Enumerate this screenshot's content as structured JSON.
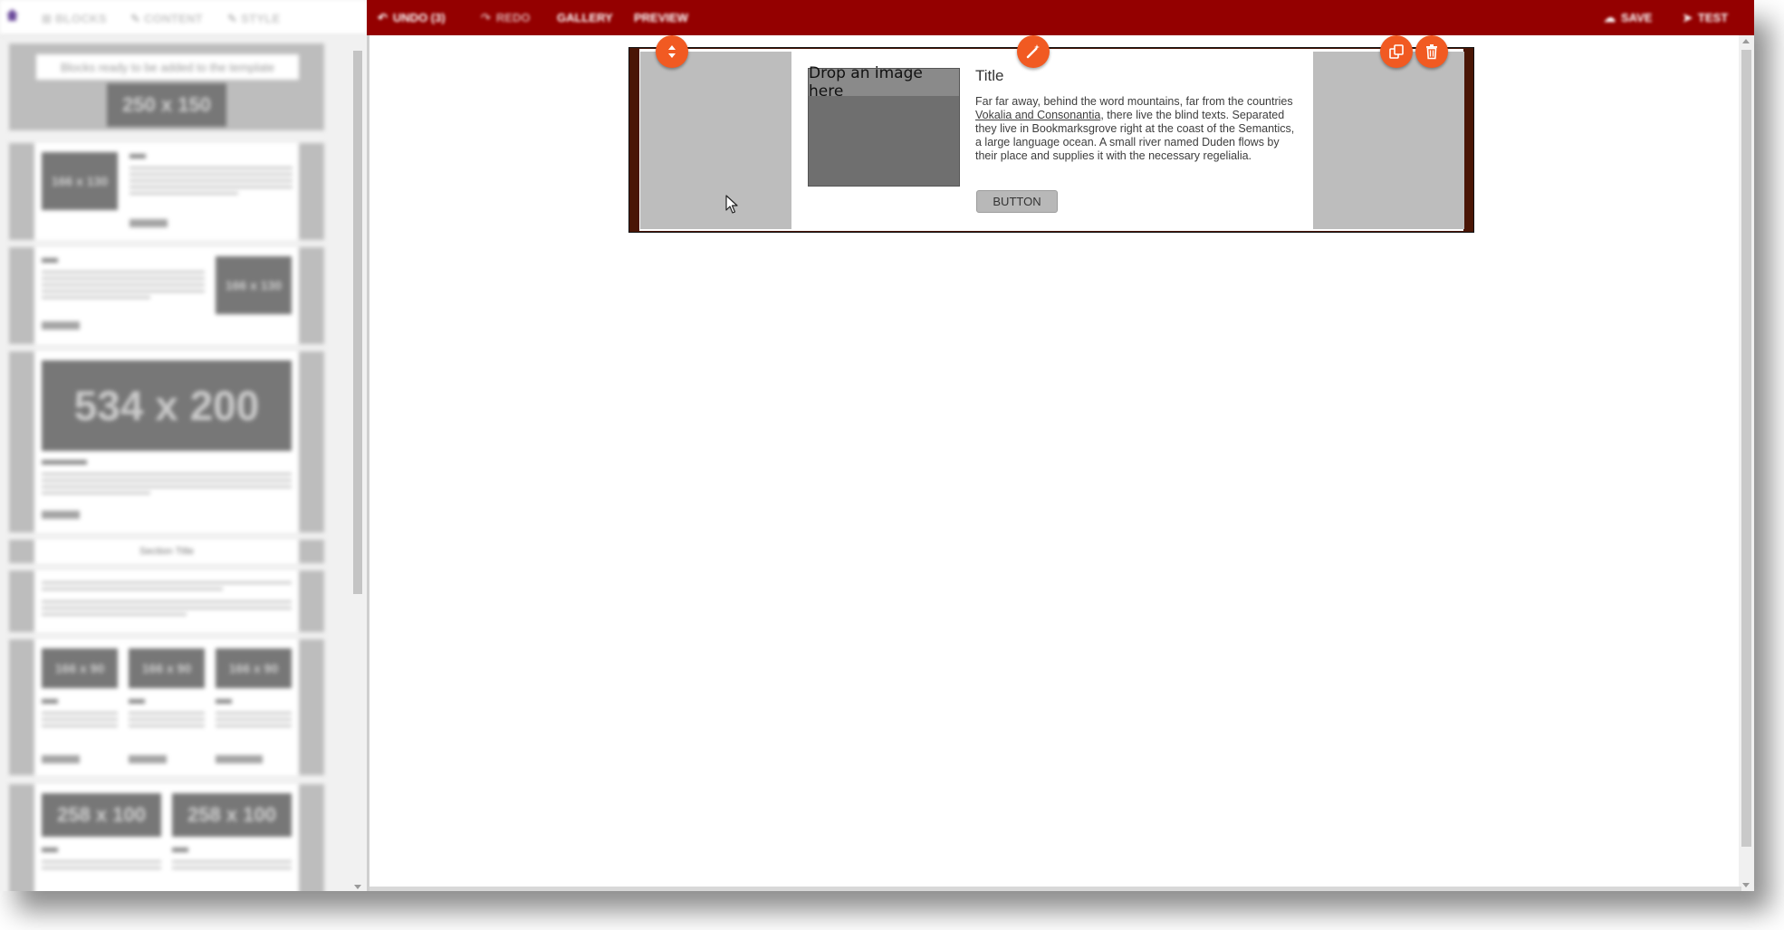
{
  "left_tabs": {
    "blocks": "BLOCKS",
    "content": "CONTENT",
    "style": "STYLE"
  },
  "blocks_list": {
    "hint": "Blocks ready to be added to the template",
    "placeholder_250x150": "250 x 150",
    "placeholder_166x130": "166 x 130",
    "placeholder_534x200": "534 x 200",
    "placeholder_166x90": "166 x 90",
    "placeholder_258x100": "258 x 100",
    "title": "Title",
    "section_title": "Section Title"
  },
  "toolbar": {
    "undo": "UNDO (3)",
    "redo": "REDO",
    "gallery": "GALLERY",
    "preview": "PREVIEW",
    "save": "SAVE",
    "test": "TEST"
  },
  "block": {
    "drop_label": "Drop an image here",
    "title": "Title",
    "text_before": "Far far away, behind the word mountains, far from the countries ",
    "text_link": "Vokalia and Consonantia",
    "text_after": ", there live the blind texts. Separated they live in Bookmarksgrove right at the coast of the Semantics, a large language ocean. A small river named Duden flows by their place and supplies it with the necessary regelialia.",
    "button": "BUTTON"
  },
  "colors": {
    "topbar": "#940000",
    "orb": "#f15a22",
    "block_border": "#4a1606"
  },
  "icons": {
    "move": "move-icon",
    "wand": "magic-wand-icon",
    "duplicate": "duplicate-icon",
    "delete": "trash-icon"
  }
}
